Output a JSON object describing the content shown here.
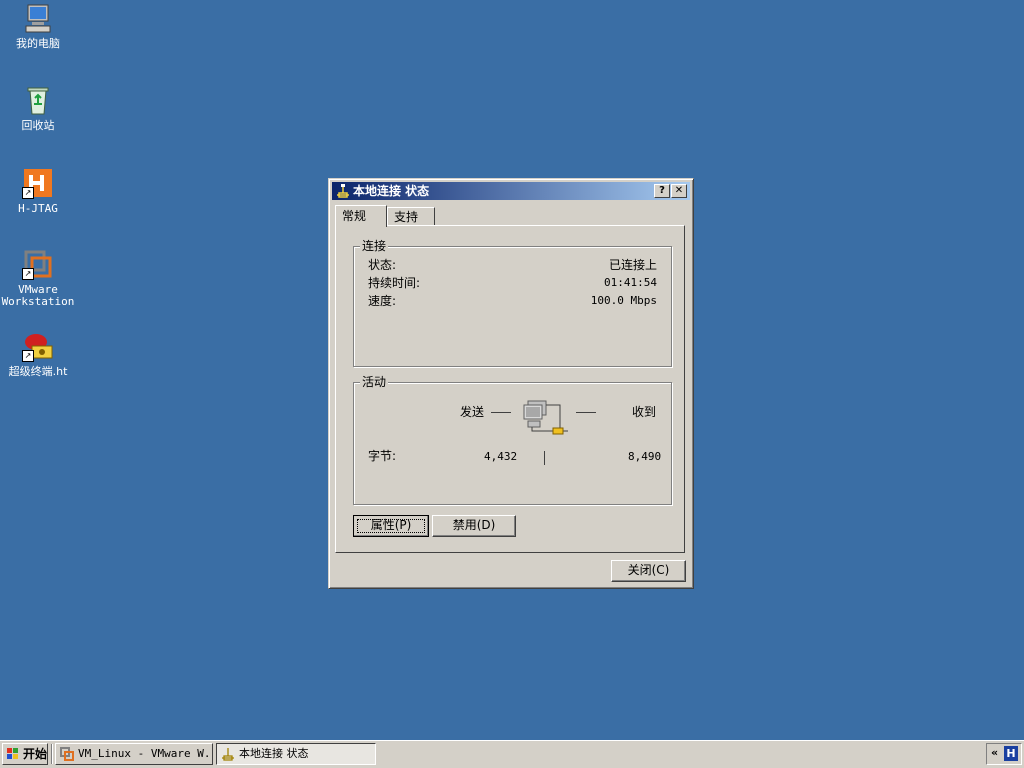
{
  "desktop": {
    "icons": [
      {
        "label": "我的电脑",
        "icon": "my-computer-icon"
      },
      {
        "label": "回收站",
        "icon": "recycle-bin-icon"
      },
      {
        "label": "H-JTAG",
        "icon": "h-jtag-icon"
      },
      {
        "label": "VMware\nWorkstation",
        "icon": "vmware-icon"
      },
      {
        "label": "超级终端.ht",
        "icon": "hyperterminal-icon"
      }
    ]
  },
  "dialog": {
    "title": "本地连接 状态",
    "help_glyph": "?",
    "close_glyph": "✕",
    "tabs": [
      {
        "label": "常规",
        "active": true
      },
      {
        "label": "支持",
        "active": false
      }
    ],
    "connection": {
      "group_title": "连接",
      "rows": [
        {
          "label": "状态:",
          "value": "已连接上"
        },
        {
          "label": "持续时间:",
          "value": "01:41:54"
        },
        {
          "label": "速度:",
          "value": "100.0 Mbps"
        }
      ]
    },
    "activity": {
      "group_title": "活动",
      "sent_label": "发送",
      "received_label": "收到",
      "bytes_label": "字节:",
      "bytes_sent": "4,432",
      "bytes_received": "8,490"
    },
    "buttons": {
      "properties": "属性(P)",
      "disable": "禁用(D)",
      "close": "关闭(C)"
    }
  },
  "taskbar": {
    "start_label": "开始",
    "tasks": [
      {
        "label": "VM_Linux - VMware W...",
        "pressed": false
      },
      {
        "label": "本地连接 状态",
        "pressed": true
      }
    ],
    "tray_chevron": "«",
    "tray_icon_letter": "H"
  }
}
